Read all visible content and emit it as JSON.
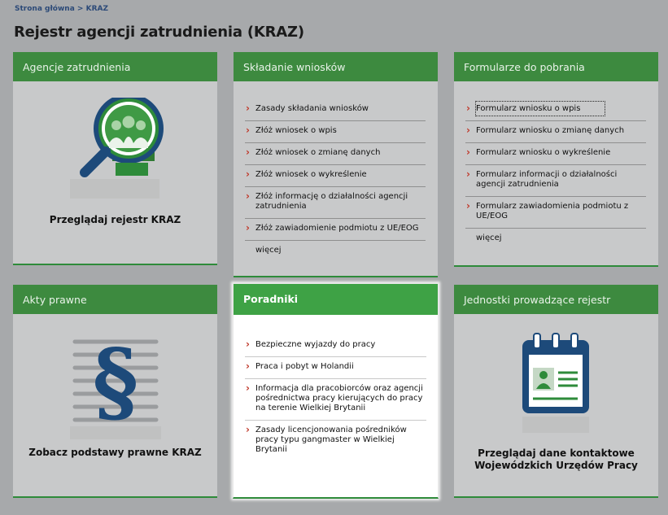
{
  "breadcrumb": {
    "home": "Strona główna",
    "sep": " > ",
    "current": "KRAZ"
  },
  "page_title": "Rejestr agencji zatrudnienia (KRAZ)",
  "cards": {
    "agencies": {
      "title": "Agencje zatrudnienia",
      "caption": "Przeglądaj rejestr KRAZ",
      "icon": "magnifier-people-icon"
    },
    "applications": {
      "title": "Składanie wniosków",
      "items": [
        "Zasady składania wniosków",
        "Złóż wniosek o wpis",
        "Złóż wniosek o zmianę danych",
        "Złóż wniosek o wykreślenie",
        "Złóż informację o działalności agencji zatrudnienia",
        "Złóż zawiadomienie podmiotu z UE/EOG"
      ],
      "more": "więcej"
    },
    "forms": {
      "title": "Formularze do pobrania",
      "items": [
        "Formularz wniosku o wpis",
        "Formularz wniosku o zmianę danych",
        "Formularz wniosku o wykreślenie",
        "Formularz informacji o działalności agencji zatrudnienia",
        "Formularz zawiadomienia podmiotu z UE/EOG"
      ],
      "more": "więcej"
    },
    "legal": {
      "title": "Akty prawne",
      "caption": "Zobacz podstawy prawne KRAZ",
      "icon": "paragraph-icon"
    },
    "guides": {
      "title": "Poradniki",
      "items": [
        "Bezpieczne wyjazdy do pracy",
        "Praca i pobyt w Holandii",
        "Informacja dla pracobiorców oraz agencji pośrednictwa pracy kierujących do pracy na terenie Wielkiej Brytanii",
        "Zasady licencjonowania pośredników pracy typu gangmaster w Wielkiej Brytanii"
      ]
    },
    "units": {
      "title": "Jednostki prowadzące rejestr",
      "caption_line1": "Przeglądaj dane kontaktowe",
      "caption_line2": "Wojewódzkich Urzędów Pracy",
      "icon": "calendar-contact-icon"
    }
  },
  "colors": {
    "header_green": "#3d8a3f",
    "accent_red": "#c0392b",
    "icon_blue": "#1d4a7a"
  }
}
